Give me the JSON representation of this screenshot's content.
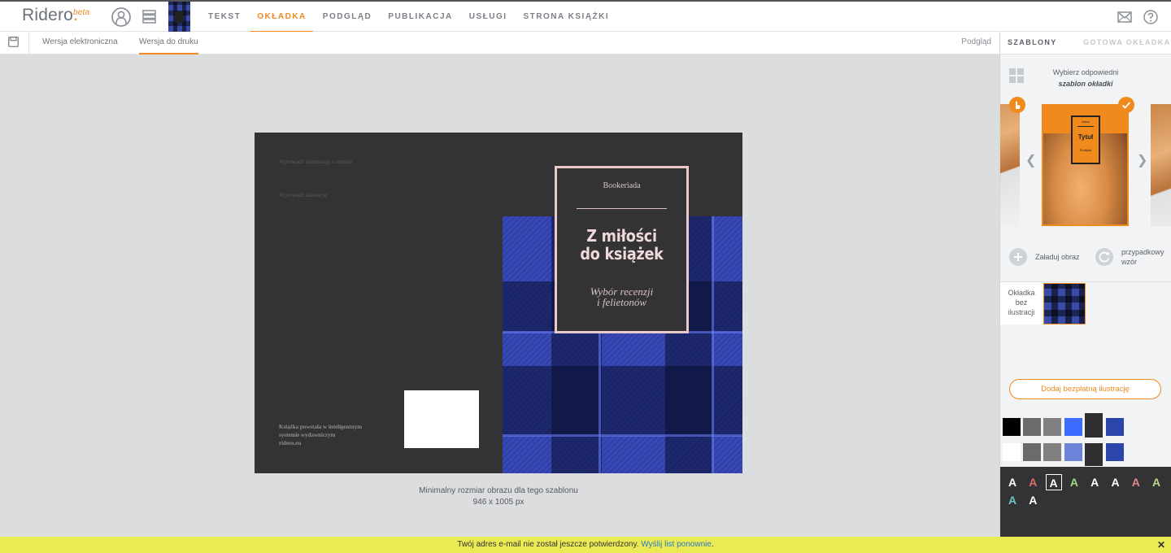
{
  "app": {
    "logo": "Ridero",
    "logo_dot": ".",
    "logo_badge": "beta"
  },
  "nav": {
    "items": [
      {
        "label": "TEKST"
      },
      {
        "label": "OKŁADKA",
        "active": true
      },
      {
        "label": "PODGLĄD"
      },
      {
        "label": "PUBLIKACJA"
      },
      {
        "label": "USŁUGI"
      },
      {
        "label": "STRONA KSIĄŻKI"
      }
    ]
  },
  "icons": {
    "account": "user-circle-icon",
    "layers": "layers-icon",
    "mail": "mail-icon",
    "help": "help-icon",
    "save": "save-icon",
    "grid": "grid-icon",
    "check": "checkmark",
    "hand": "hand-pointer-icon"
  },
  "subnav": {
    "tabs": [
      {
        "label": "Wersja elektroniczna"
      },
      {
        "label": "Wersja do druku",
        "active": true
      }
    ],
    "preview": "Podgląd"
  },
  "cover": {
    "back": {
      "author_info": "Wprowadź informację o autorze",
      "annotation": "Wprowadź adnotację",
      "footer_line1": "Książka powstała w inteligentnym",
      "footer_line2": "systemie wydawniczym",
      "footer_line3": "ridero.eu"
    },
    "front": {
      "publisher": "Bookeriada",
      "title_line1": "Z miłości",
      "title_line2": "do książek",
      "subtitle_line1": "Wybór recenzji",
      "subtitle_line2": "i felietonów"
    },
    "min_size_line1": "Minimalny rozmiar obrazu dla tego szablonu",
    "min_size_line2": "946 x 1005 px"
  },
  "panel": {
    "tabs": [
      {
        "label": "SZABLONY",
        "active": true
      },
      {
        "label": "GOTOWA OKŁADKA"
      }
    ],
    "choose_line1": "Wybierz odpowiedni",
    "choose_line2": "szablon okładki",
    "template_preview": {
      "author": "Autor",
      "title": "Tytuł",
      "subtitle": "Podtytuł"
    },
    "upload_label": "Załaduj obraz",
    "random_line1": "przypadkowy",
    "random_line2": "wzór",
    "no_illustration_line1": "Okładka",
    "no_illustration_line2": "bez",
    "no_illustration_line3": "ilustracji",
    "add_free_illustration": "Dodaj bezpłatną ilustrację",
    "swatches_row1": [
      "#000000",
      "#6b6b6b",
      "#808080",
      "#3b6cff",
      "#2f2f31",
      "#2c45a8"
    ],
    "swatches_row2": [
      "#ffffff",
      "#6b6b6b",
      "#808080",
      "#6b83d8",
      "#2f2f31",
      "#2c45a8"
    ],
    "font_glyph": "A",
    "font_colors_row1": [
      "#ffffff",
      "#e06a6a",
      "#ffffff",
      "#a5d87a",
      "#ffffff",
      "#ffffff",
      "#e08a8a",
      "#b9d88a"
    ],
    "font_colors_row2": [
      "#6cc6c6",
      "#ffffff"
    ]
  },
  "notice": {
    "text": "Twój adres e-mail nie został jeszcze potwierdzony.",
    "link": "Wyślij list ponownie",
    "tail": ".",
    "close": "✕"
  }
}
